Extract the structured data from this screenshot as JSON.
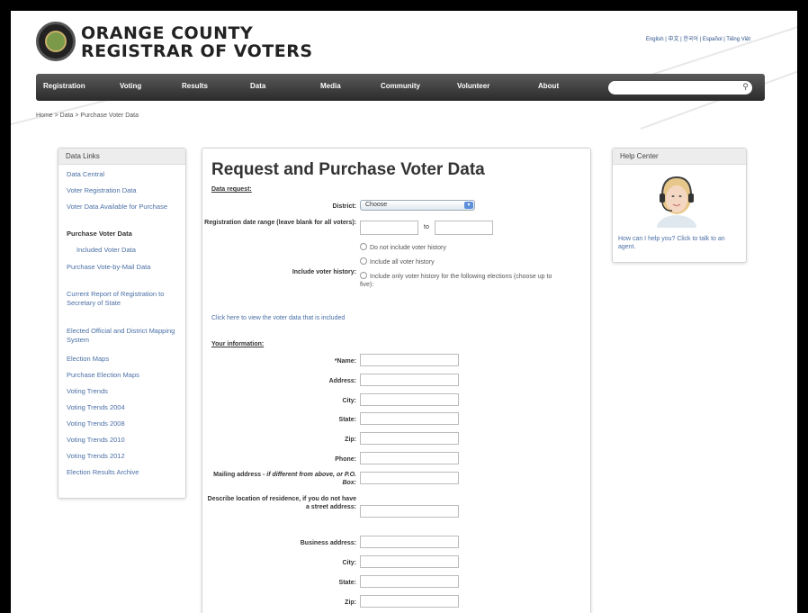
{
  "header": {
    "logo_line1": "ORANGE COUNTY",
    "logo_line2": "REGISTRAR OF VOTERS",
    "languages": "English | 中文 | 한국어 | Español | Tiếng Việt"
  },
  "nav": {
    "items": [
      "Registration",
      "Voting",
      "Results",
      "Data",
      "Media",
      "Community",
      "Volunteer",
      "About"
    ],
    "search_placeholder": ""
  },
  "breadcrumb": "Home > Data > Purchase Voter Data",
  "sidebar": {
    "title": "Data Links",
    "links": [
      "Data Central",
      "Voter Registration Data",
      "Voter Data Available for Purchase",
      "Purchase Voter Data",
      "Included Voter Data",
      "Purchase Vote-by-Mail Data",
      "Current Report of Registration to Secretary of State",
      "Elected Official and District Mapping System",
      "Election Maps",
      "Purchase Election Maps",
      "Voting Trends",
      "Voting Trends 2004",
      "Voting Trends 2008",
      "Voting Trends 2010",
      "Voting Trends 2012",
      "Election Results Archive"
    ],
    "active_index": 3
  },
  "main": {
    "title": "Request and Purchase Voter Data",
    "data_request_heading": "Data request:",
    "district_label": "District:",
    "district_value": "Choose",
    "date_range_label": "Registration date range (leave blank for all voters):",
    "date_to": "to",
    "history_label": "Include voter history:",
    "history_options": [
      "Do not include voter history",
      "Include all voter history",
      "Include only voter history for the following elections (choose up to five):"
    ],
    "view_link": "Click here to view the voter data that is included",
    "your_info_heading": "Your information:",
    "fields": {
      "name": "*Name:",
      "address": "Address:",
      "city": "City:",
      "state": "State:",
      "zip": "Zip:",
      "phone": "Phone:",
      "mailing_a": "Mailing address - ",
      "mailing_b": "if different from above, or P.O. Box:",
      "describe": "Describe location of residence, if you do not have a street address:",
      "business": "Business address:",
      "city2": "City:",
      "state2": "State:",
      "zip2": "Zip:"
    }
  },
  "help": {
    "title": "Help Center",
    "text": "How can I help you? Click to talk to an agent."
  }
}
